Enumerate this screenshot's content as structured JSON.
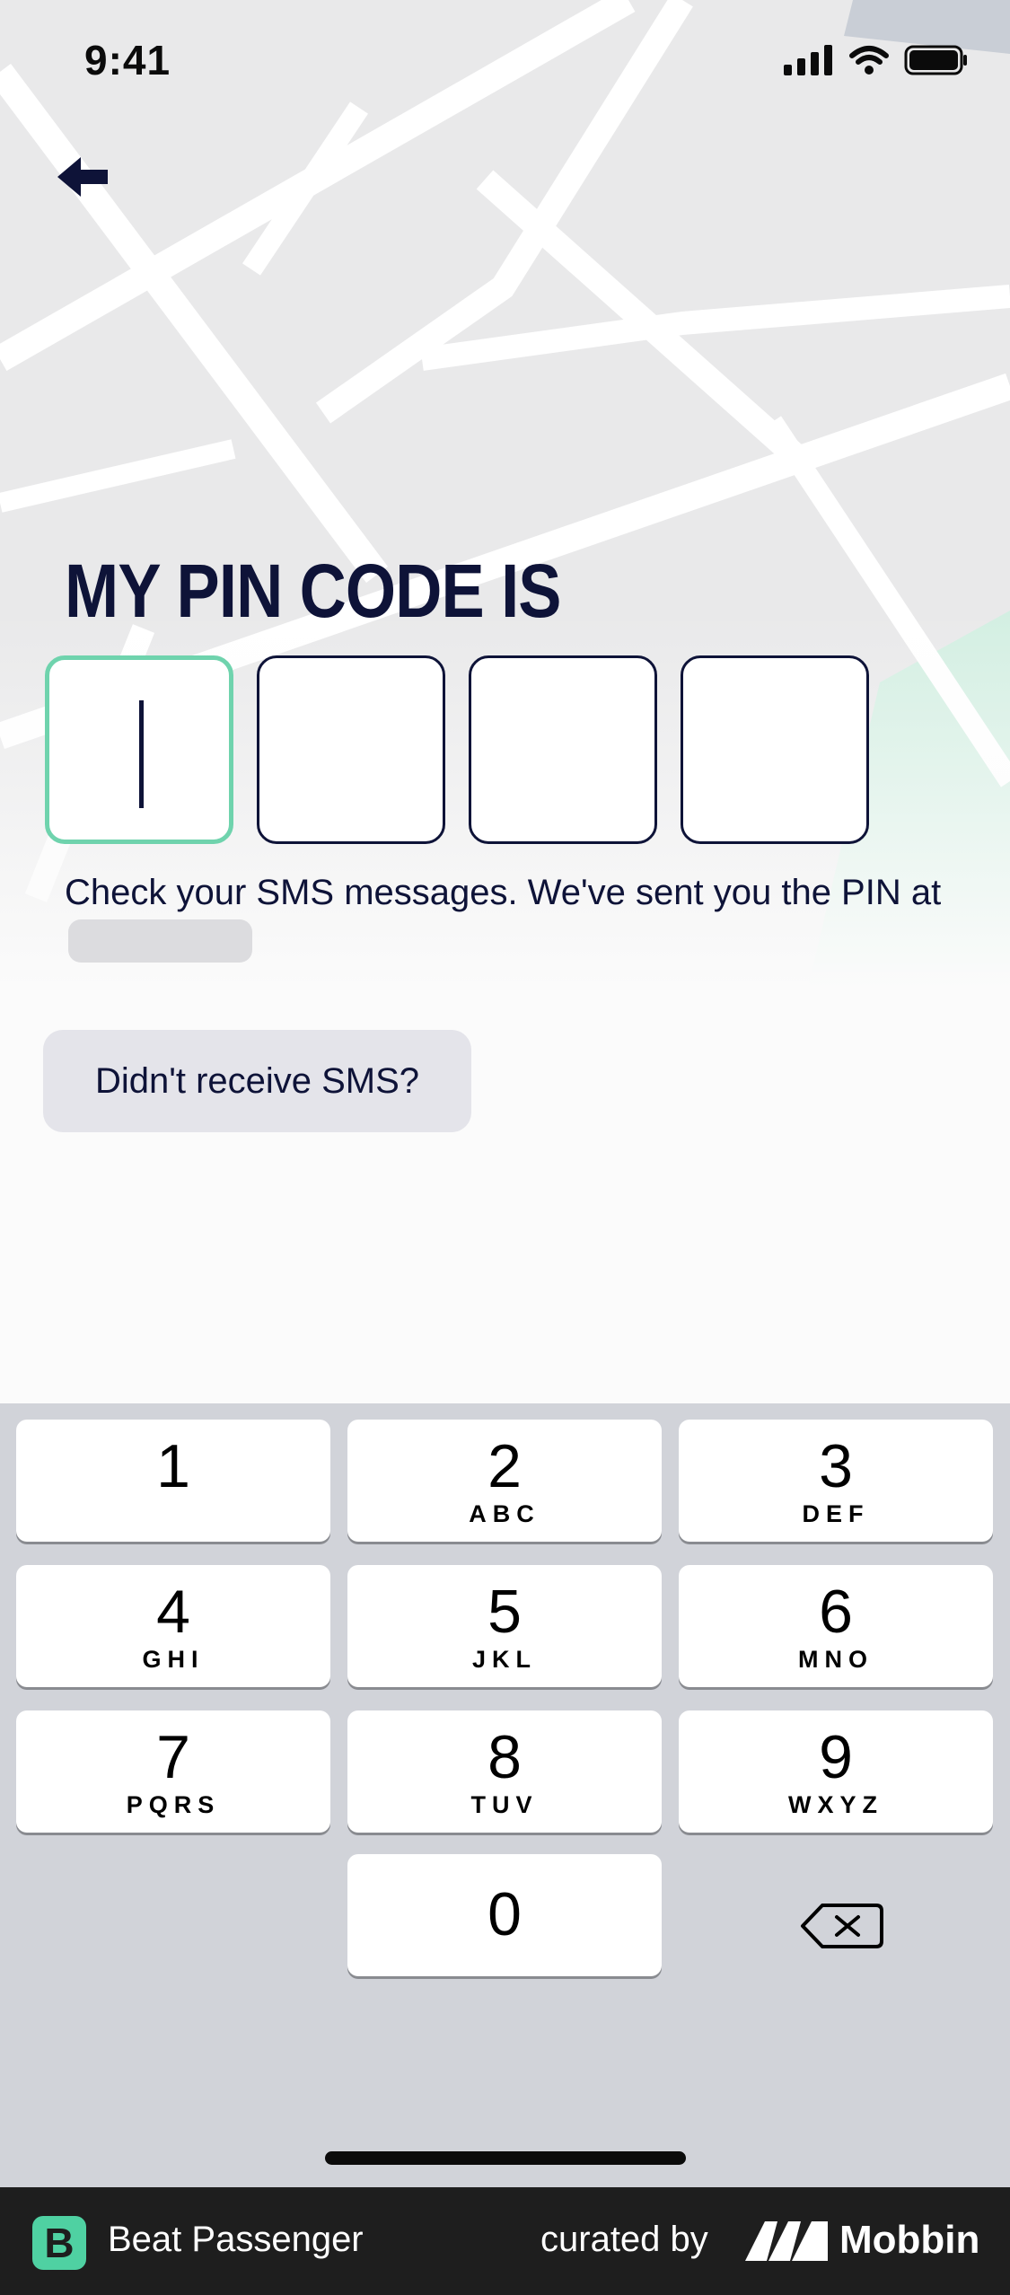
{
  "status_bar": {
    "time": "9:41"
  },
  "title": "MY PIN CODE IS",
  "helper_text": "Check your SMS messages. We've sent you the PIN at",
  "resend_label": "Didn't receive SMS?",
  "keypad": [
    {
      "digit": "1",
      "letters": ""
    },
    {
      "digit": "2",
      "letters": "ABC"
    },
    {
      "digit": "3",
      "letters": "DEF"
    },
    {
      "digit": "4",
      "letters": "GHI"
    },
    {
      "digit": "5",
      "letters": "JKL"
    },
    {
      "digit": "6",
      "letters": "MNO"
    },
    {
      "digit": "7",
      "letters": "PQRS"
    },
    {
      "digit": "8",
      "letters": "TUV"
    },
    {
      "digit": "9",
      "letters": "WXYZ"
    },
    {
      "digit": "0",
      "letters": ""
    }
  ],
  "footer": {
    "logo_letter": "B",
    "app_name": "Beat Passenger",
    "curated_by": "curated by",
    "brand": "Mobbin"
  },
  "colors": {
    "accent": "#6fd3ad",
    "navy": "#0e1338",
    "keypad_bg": "#d1d3d9",
    "footer_bg": "#1e1e1e",
    "logo_green": "#4fd1a2"
  },
  "icons": [
    "back-arrow-icon",
    "signal-icon",
    "wifi-icon",
    "battery-icon",
    "backspace-icon"
  ]
}
